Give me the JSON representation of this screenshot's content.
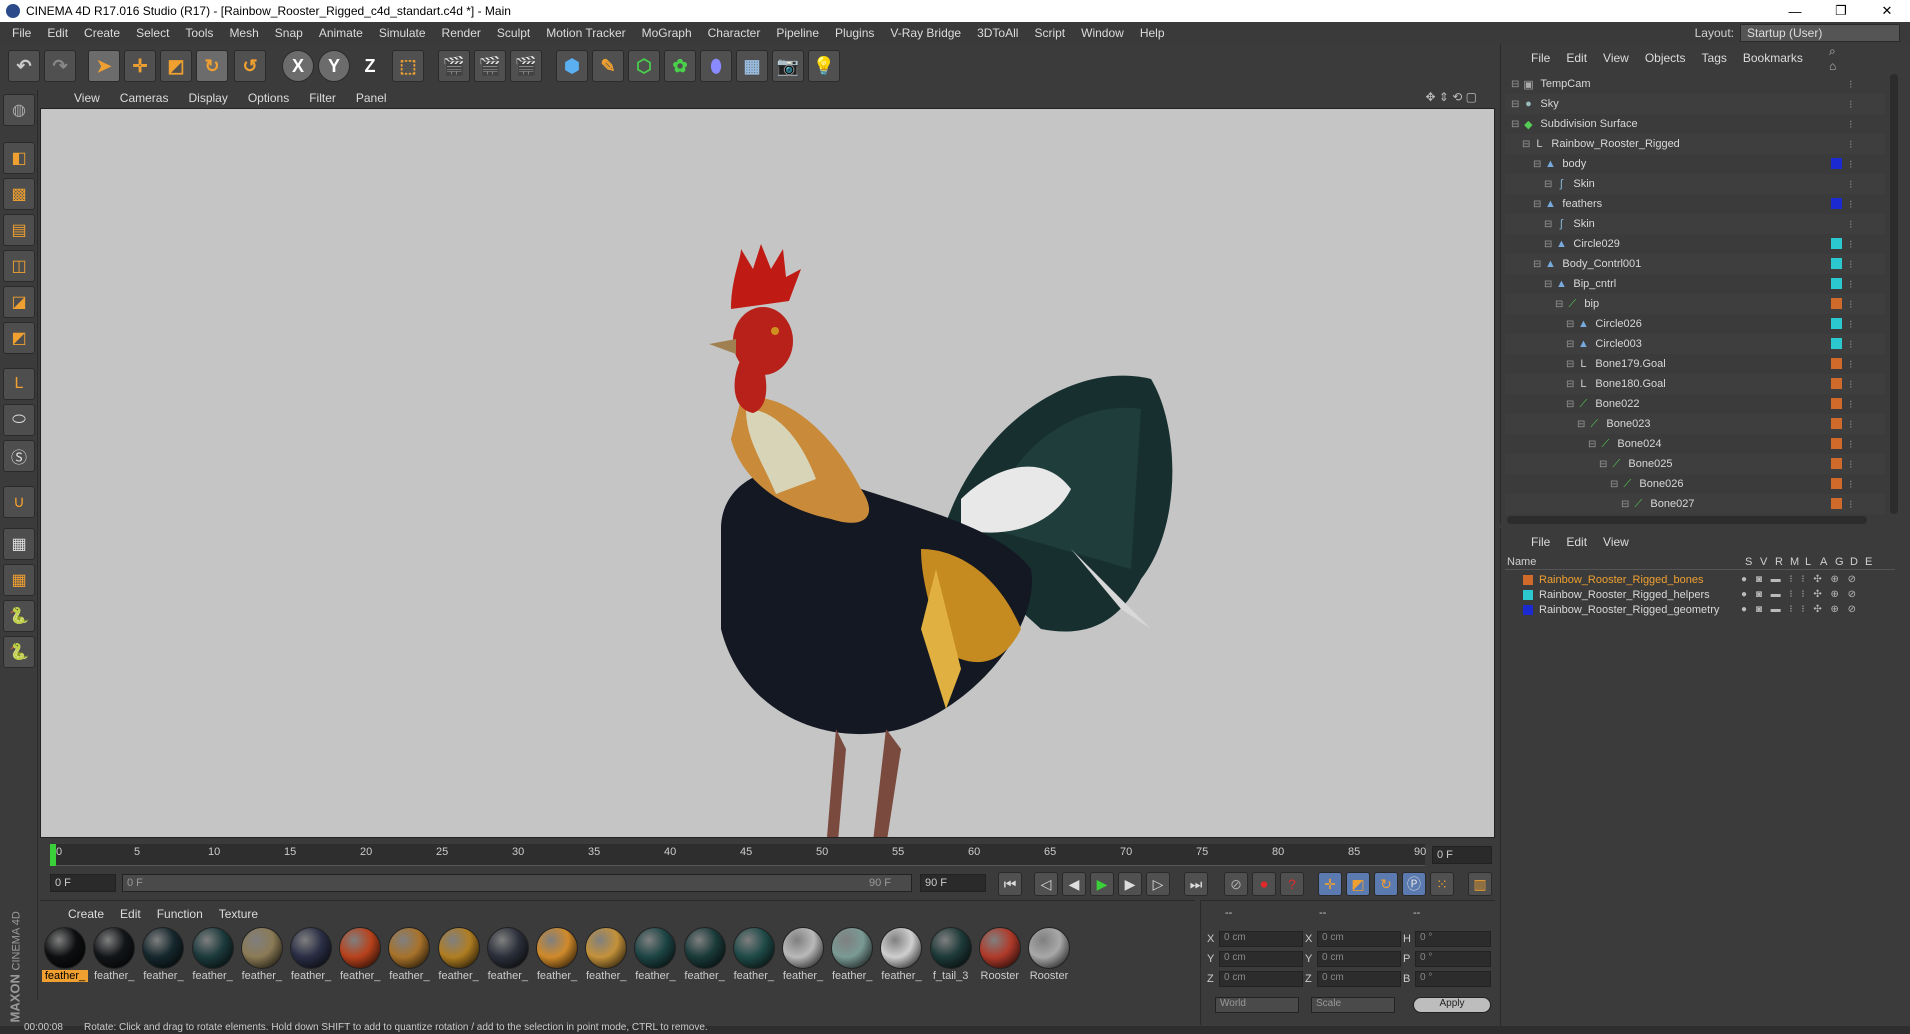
{
  "window": {
    "title": "CINEMA 4D R17.016 Studio (R17) - [Rainbow_Rooster_Rigged_c4d_standart.c4d *] - Main",
    "controls": [
      "—",
      "❐",
      "✕"
    ]
  },
  "menubar": {
    "items": [
      "File",
      "Edit",
      "Create",
      "Select",
      "Tools",
      "Mesh",
      "Snap",
      "Animate",
      "Simulate",
      "Render",
      "Sculpt",
      "Motion Tracker",
      "MoGraph",
      "Character",
      "Pipeline",
      "Plugins",
      "V-Ray Bridge",
      "3DToAll",
      "Script",
      "Window",
      "Help"
    ],
    "layout_label": "Layout:",
    "layout_value": "Startup (User)"
  },
  "toolbar": {
    "axis_x": "X",
    "axis_y": "Y",
    "axis_z": "Z"
  },
  "viewport": {
    "menu": [
      "View",
      "Cameras",
      "Display",
      "Options",
      "Filter",
      "Panel"
    ]
  },
  "timeline": {
    "ticks": [
      "0",
      "5",
      "10",
      "15",
      "20",
      "25",
      "30",
      "35",
      "40",
      "45",
      "50",
      "55",
      "60",
      "65",
      "70",
      "75",
      "80",
      "85",
      "90"
    ],
    "current_frame": "0 F",
    "start": "0 F",
    "range_start": "0 F",
    "range_end": "90 F",
    "end": "90 F"
  },
  "materials": {
    "menu": [
      "Create",
      "Edit",
      "Function",
      "Texture"
    ],
    "items": [
      {
        "label": "feather_",
        "color": "#0d0f10",
        "selected": true
      },
      {
        "label": "feather_",
        "color": "#121518"
      },
      {
        "label": "feather_",
        "color": "#15272d"
      },
      {
        "label": "feather_",
        "color": "#1c3a3c"
      },
      {
        "label": "feather_",
        "color": "#8a7a55"
      },
      {
        "label": "feather_",
        "color": "#2a2e45"
      },
      {
        "label": "feather_",
        "color": "#b8421c"
      },
      {
        "label": "feather_",
        "color": "#a8722a"
      },
      {
        "label": "feather_",
        "color": "#b07e22"
      },
      {
        "label": "feather_",
        "color": "#2b2f3a"
      },
      {
        "label": "feather_",
        "color": "#d08a2a"
      },
      {
        "label": "feather_",
        "color": "#c4923a"
      },
      {
        "label": "feather_",
        "color": "#1d4444"
      },
      {
        "label": "feather_",
        "color": "#1a3a3a"
      },
      {
        "label": "feather_",
        "color": "#1f4a48"
      },
      {
        "label": "feather_",
        "color": "#b9b9b9"
      },
      {
        "label": "feather_",
        "color": "#7a9a94"
      },
      {
        "label": "feather_",
        "color": "#cfcfcf"
      },
      {
        "label": "f_tail_3",
        "color": "#1d3a38"
      },
      {
        "label": "Rooster",
        "color": "#b03a2a"
      },
      {
        "label": "Rooster",
        "color": "#a8a8a8"
      }
    ]
  },
  "coords": {
    "header": [
      "--",
      "--",
      "--"
    ],
    "rows": [
      {
        "a": "X",
        "av": "0 cm",
        "b": "X",
        "bv": "0 cm",
        "c": "H",
        "cv": "0 °"
      },
      {
        "a": "Y",
        "av": "0 cm",
        "b": "Y",
        "bv": "0 cm",
        "c": "P",
        "cv": "0 °"
      },
      {
        "a": "Z",
        "av": "0 cm",
        "b": "Z",
        "bv": "0 cm",
        "c": "B",
        "cv": "0 °"
      }
    ],
    "world": "World",
    "scale": "Scale",
    "apply": "Apply"
  },
  "objects": {
    "menu": [
      "File",
      "Edit",
      "View",
      "Objects",
      "Tags",
      "Bookmarks"
    ],
    "rows": [
      {
        "name": "TempCam",
        "indent": 0,
        "icon": "camera-icon",
        "glyph": "▣",
        "color": "#aaa",
        "layer": null
      },
      {
        "name": "Sky",
        "indent": 0,
        "icon": "sky-icon",
        "glyph": "●",
        "color": "#9bb",
        "layer": null
      },
      {
        "name": "Subdivision Surface",
        "indent": 0,
        "icon": "subdivision-icon",
        "glyph": "◆",
        "color": "#5c5",
        "layer": null
      },
      {
        "name": "Rainbow_Rooster_Rigged",
        "indent": 1,
        "icon": "null-icon",
        "glyph": "L",
        "color": "#ccc",
        "layer": null
      },
      {
        "name": "body",
        "indent": 2,
        "icon": "polygon-icon",
        "glyph": "▲",
        "color": "#7ad",
        "layer": "#1a2ad0"
      },
      {
        "name": "Skin",
        "indent": 3,
        "icon": "skin-icon",
        "glyph": "ʃ",
        "color": "#8bd",
        "layer": null
      },
      {
        "name": "feathers",
        "indent": 2,
        "icon": "polygon-icon",
        "glyph": "▲",
        "color": "#7ad",
        "layer": "#1a2ad0"
      },
      {
        "name": "Skin",
        "indent": 3,
        "icon": "skin-icon",
        "glyph": "ʃ",
        "color": "#8bd",
        "layer": null
      },
      {
        "name": "Circle029",
        "indent": 3,
        "icon": "spline-icon",
        "glyph": "▲",
        "color": "#7ad",
        "layer": "#2cc8d0"
      },
      {
        "name": "Body_Contrl001",
        "indent": 2,
        "icon": "spline-icon",
        "glyph": "▲",
        "color": "#7ad",
        "layer": "#2cc8d0"
      },
      {
        "name": "Bip_cntrl",
        "indent": 3,
        "icon": "spline-icon",
        "glyph": "▲",
        "color": "#7ad",
        "layer": "#2cc8d0"
      },
      {
        "name": "bip",
        "indent": 4,
        "icon": "bone-icon",
        "glyph": "⟋",
        "color": "#5c5",
        "layer": "#d06a2a"
      },
      {
        "name": "Circle026",
        "indent": 5,
        "icon": "spline-icon",
        "glyph": "▲",
        "color": "#7ad",
        "layer": "#2cc8d0"
      },
      {
        "name": "Circle003",
        "indent": 5,
        "icon": "spline-icon",
        "glyph": "▲",
        "color": "#7ad",
        "layer": "#2cc8d0"
      },
      {
        "name": "Bone179.Goal",
        "indent": 5,
        "icon": "null-icon",
        "glyph": "L",
        "color": "#ccc",
        "layer": "#d06a2a"
      },
      {
        "name": "Bone180.Goal",
        "indent": 5,
        "icon": "null-icon",
        "glyph": "L",
        "color": "#ccc",
        "layer": "#d06a2a"
      },
      {
        "name": "Bone022",
        "indent": 5,
        "icon": "bone-icon",
        "glyph": "⟋",
        "color": "#5c5",
        "layer": "#d06a2a"
      },
      {
        "name": "Bone023",
        "indent": 6,
        "icon": "bone-icon",
        "glyph": "⟋",
        "color": "#5c5",
        "layer": "#d06a2a"
      },
      {
        "name": "Bone024",
        "indent": 7,
        "icon": "bone-icon",
        "glyph": "⟋",
        "color": "#5c5",
        "layer": "#d06a2a"
      },
      {
        "name": "Bone025",
        "indent": 8,
        "icon": "bone-icon",
        "glyph": "⟋",
        "color": "#5c5",
        "layer": "#d06a2a"
      },
      {
        "name": "Bone026",
        "indent": 9,
        "icon": "bone-icon",
        "glyph": "⟋",
        "color": "#5c5",
        "layer": "#d06a2a"
      },
      {
        "name": "Bone027",
        "indent": 10,
        "icon": "bone-icon",
        "glyph": "⟋",
        "color": "#5c5",
        "layer": "#d06a2a"
      }
    ]
  },
  "layers": {
    "menu": [
      "File",
      "Edit",
      "View"
    ],
    "col_name": "Name",
    "cols": [
      "S",
      "V",
      "R",
      "M",
      "L",
      "A",
      "G",
      "D",
      "E"
    ],
    "rows": [
      {
        "name": "Rainbow_Rooster_Rigged_bones",
        "color": "#d06a2a",
        "text_color": "#f0a030"
      },
      {
        "name": "Rainbow_Rooster_Rigged_helpers",
        "color": "#2cc8d0",
        "text_color": "#d8d8d8"
      },
      {
        "name": "Rainbow_Rooster_Rigged_geometry",
        "color": "#1a2ad0",
        "text_color": "#d8d8d8"
      }
    ]
  },
  "status": {
    "time": "00:00:08",
    "message": "Rotate: Click and drag to rotate elements. Hold down SHIFT to add to quantize rotation / add to the selection in point mode, CTRL to remove."
  },
  "branding": {
    "line1": "MAXON",
    "line2": "CINEMA 4D"
  }
}
